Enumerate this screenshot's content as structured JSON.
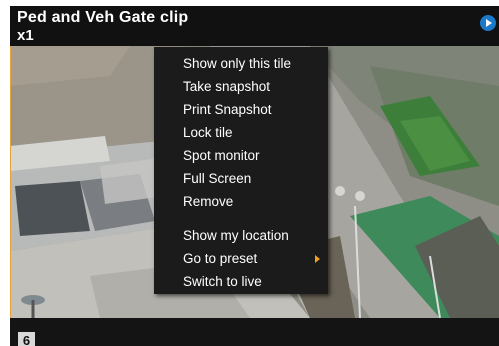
{
  "tile": {
    "title": "Ped and Veh Gate clip",
    "speed": "x1",
    "number": "6",
    "play_icon": "play-icon"
  },
  "menu": {
    "items": [
      {
        "label": "Show only this tile"
      },
      {
        "label": "Take snapshot"
      },
      {
        "label": "Print Snapshot"
      },
      {
        "label": "Lock tile"
      },
      {
        "label": "Spot monitor"
      },
      {
        "label": "Full Screen"
      },
      {
        "label": "Remove"
      },
      {
        "label": "Show my location"
      },
      {
        "label": "Go to preset",
        "submenu": true
      },
      {
        "label": "Switch to live"
      }
    ]
  },
  "colors": {
    "accent": "#1c78c8",
    "submenu_arrow": "#f0a020",
    "menu_bg": "#1b1b1b"
  }
}
